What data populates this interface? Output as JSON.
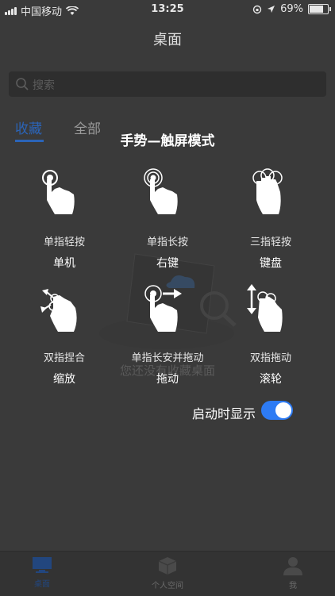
{
  "status_bar": {
    "carrier": "中国移动",
    "time": "13:25",
    "battery": "69%",
    "battery_level": 0.69
  },
  "nav": {
    "title": "桌面"
  },
  "search": {
    "placeholder": "搜索"
  },
  "tabs": [
    {
      "label": "收藏",
      "active": true
    },
    {
      "label": "全部",
      "active": false
    }
  ],
  "empty_state": {
    "text": "您还没有收藏桌面"
  },
  "overlay": {
    "title": "手势—触屏模式",
    "gestures": [
      {
        "name": "单指轻按",
        "action": "单机",
        "icon": "single-tap-icon"
      },
      {
        "name": "单指长按",
        "action": "右键",
        "icon": "long-press-icon"
      },
      {
        "name": "三指轻按",
        "action": "键盘",
        "icon": "three-finger-tap-icon"
      },
      {
        "name": "双指捏合",
        "action": "缩放",
        "icon": "pinch-icon"
      },
      {
        "name": "单指长安并拖动",
        "action": "拖动",
        "icon": "press-drag-icon"
      },
      {
        "name": "双指拖动",
        "action": "滚轮",
        "icon": "two-finger-drag-icon"
      }
    ],
    "show_on_start_label": "启动时显示",
    "show_on_start": true
  },
  "tab_bar": [
    {
      "label": "桌面",
      "icon": "desktop-icon",
      "active": true
    },
    {
      "label": "个人空间",
      "icon": "cube-icon",
      "active": false
    },
    {
      "label": "我",
      "icon": "person-icon",
      "active": false
    }
  ],
  "colors": {
    "accent": "#2b64b8",
    "toggle_on": "#2d7bf4",
    "overlay_bg": "#3a3a3a"
  }
}
